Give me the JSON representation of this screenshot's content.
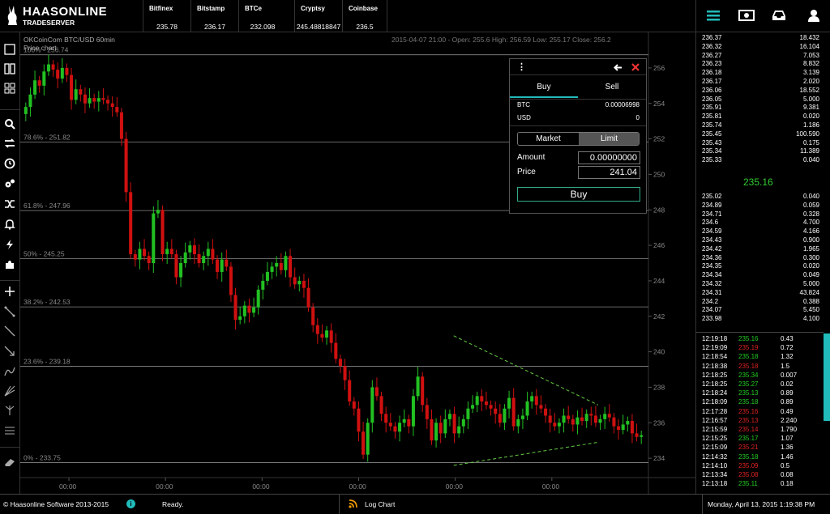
{
  "app": {
    "name": "HAASONLINE",
    "subtitle": "TRADESERVER"
  },
  "tickers": [
    {
      "exchange": "Bitfinex",
      "price": "235.78"
    },
    {
      "exchange": "Bitstamp",
      "price": "236.17"
    },
    {
      "exchange": "BTCe",
      "price": "232.098"
    },
    {
      "exchange": "Cryptsy",
      "price": "245.48818847"
    },
    {
      "exchange": "Coinbase",
      "price": "236.5"
    }
  ],
  "top_icons": [
    "menu-icon",
    "money-icon",
    "inbox-icon",
    "user-icon"
  ],
  "chart": {
    "title": "OKCoinCom BTC/USD 60min",
    "subtitle": "Price chart",
    "ohlc": "2015-04-07 21:00 - Open: 255.6 High: 256.59 Low: 255.17 Close: 256.2",
    "colors": {
      "up": "#22c022",
      "down": "#d01010",
      "fib": "#888888",
      "trend": "#66cc44"
    }
  },
  "chart_data": {
    "type": "candlestick",
    "title": "OKCoinCom BTC/USD 60min",
    "ylim": [
      233,
      257
    ],
    "y_ticks": [
      234,
      236,
      238,
      240,
      242,
      244,
      246,
      248,
      250,
      252,
      254,
      256
    ],
    "x_tick_labels": [
      "00:00",
      "00:00",
      "00:00",
      "00:00",
      "00:00",
      "00:00"
    ],
    "fib_levels": [
      {
        "label": "100% - 256.74",
        "value": 256.74
      },
      {
        "label": "78.6% - 251.82",
        "value": 251.82
      },
      {
        "label": "61.8% - 247.96",
        "value": 247.96
      },
      {
        "label": "50% - 245.25",
        "value": 245.25
      },
      {
        "label": "38.2% - 242.53",
        "value": 242.53
      },
      {
        "label": "23.6% - 239.18",
        "value": 239.18
      },
      {
        "label": "0% - 233.75",
        "value": 233.75
      }
    ],
    "close": [
      253.8,
      254.5,
      255.3,
      255.0,
      255.8,
      256.2,
      255.9,
      255.4,
      256.0,
      255.6,
      254.2,
      254.8,
      254.5,
      254.0,
      254.3,
      254.1,
      254.3,
      254.2,
      254.0,
      253.8,
      253.5,
      252.0,
      249.0,
      245.5,
      245.2,
      245.8,
      245.4,
      245.0,
      247.8,
      248.0,
      245.5,
      245.8,
      245.5,
      244.2,
      245.0,
      245.6,
      246.0,
      245.5,
      245.0,
      245.4,
      245.8,
      245.2,
      244.5,
      245.2,
      244.8,
      243.2,
      241.8,
      242.0,
      242.6,
      242.2,
      242.5,
      243.5,
      244.0,
      244.5,
      244.8,
      245.0,
      244.6,
      245.4,
      244.2,
      243.8,
      244.0,
      243.6,
      242.5,
      241.5,
      241.0,
      240.8,
      241.2,
      240.5,
      239.6,
      239.2,
      238.4,
      237.2,
      236.8,
      235.5,
      234.2,
      236.0,
      238.0,
      237.5,
      236.5,
      236.0,
      235.8,
      235.5,
      236.0,
      236.2,
      235.8,
      237.5,
      238.6,
      237.0,
      236.2,
      235.0,
      236.0,
      235.4,
      236.2,
      236.5,
      235.4,
      235.8,
      236.2,
      236.8,
      237.0,
      237.5,
      237.2,
      237.0,
      236.8,
      236.5,
      236.0,
      236.8,
      237.4,
      235.8,
      236.2,
      236.4,
      237.2,
      237.5,
      237.0,
      236.8,
      236.4,
      236.0,
      235.8,
      236.0,
      236.4,
      236.2,
      235.9,
      236.3,
      236.1,
      236.5,
      236.4,
      236.0,
      236.2,
      236.5,
      236.3,
      235.8,
      235.6,
      235.9,
      236.1,
      235.4,
      235.2,
      235.3
    ],
    "trendlines": [
      {
        "from": [
          0.69,
          240.9
        ],
        "to": [
          0.92,
          237.0
        ]
      },
      {
        "from": [
          0.69,
          233.6
        ],
        "to": [
          0.92,
          234.9
        ]
      }
    ]
  },
  "trade_panel": {
    "tabs": [
      "Buy",
      "Sell"
    ],
    "btc_label": "BTC",
    "btc_value": "0.00006998",
    "usd_label": "USD",
    "usd_value": "0",
    "modes": [
      "Market",
      "Limit"
    ],
    "amount_label": "Amount",
    "amount_value": "0.00000000",
    "price_label": "Price",
    "price_value": "241.04",
    "buy_label": "Buy"
  },
  "orderbook": {
    "asks": [
      [
        "236.37",
        "18.432"
      ],
      [
        "236.32",
        "16.104"
      ],
      [
        "236.27",
        "7.053"
      ],
      [
        "236.23",
        "8.832"
      ],
      [
        "236.18",
        "3.139"
      ],
      [
        "236.17",
        "2.020"
      ],
      [
        "236.06",
        "18.552"
      ],
      [
        "236.05",
        "5.000"
      ],
      [
        "235.91",
        "9.381"
      ],
      [
        "235.81",
        "0.020"
      ],
      [
        "235.74",
        "1.186"
      ],
      [
        "235.45",
        "100.590"
      ],
      [
        "235.43",
        "0.175"
      ],
      [
        "235.34",
        "11.389"
      ],
      [
        "235.33",
        "0.040"
      ]
    ],
    "spread_price": "235.16",
    "bids": [
      [
        "235.02",
        "0.040"
      ],
      [
        "234.89",
        "0.059"
      ],
      [
        "234.71",
        "0.328"
      ],
      [
        "234.6",
        "4.700"
      ],
      [
        "234.59",
        "4.166"
      ],
      [
        "234.43",
        "0.900"
      ],
      [
        "234.42",
        "1.965"
      ],
      [
        "234.36",
        "0.300"
      ],
      [
        "234.35",
        "0.020"
      ],
      [
        "234.34",
        "0.049"
      ],
      [
        "234.32",
        "5.000"
      ],
      [
        "234.31",
        "43.824"
      ],
      [
        "234.2",
        "0.388"
      ],
      [
        "234.07",
        "5.450"
      ],
      [
        "233.98",
        "4.100"
      ]
    ]
  },
  "trades": [
    [
      "12:19:18",
      "235.16",
      "0.43",
      "up"
    ],
    [
      "12:19:09",
      "235.19",
      "0.72",
      "down"
    ],
    [
      "12:18:54",
      "235.18",
      "1.32",
      "up"
    ],
    [
      "12:18:38",
      "235.18",
      "1.5",
      "down"
    ],
    [
      "12:18:25",
      "235.34",
      "0.007",
      "up"
    ],
    [
      "12:18:25",
      "235.27",
      "0.02",
      "up"
    ],
    [
      "12:18:24",
      "235.13",
      "0.89",
      "up"
    ],
    [
      "12:18:09",
      "235.18",
      "0.89",
      "up"
    ],
    [
      "12:17:28",
      "235.16",
      "0.49",
      "down"
    ],
    [
      "12:16:57",
      "235.13",
      "2.240",
      "down"
    ],
    [
      "12:15:59",
      "235.14",
      "1.790",
      "down"
    ],
    [
      "12:15:25",
      "235.17",
      "1.07",
      "up"
    ],
    [
      "12:15:09",
      "235.21",
      "1.36",
      "down"
    ],
    [
      "12:14:32",
      "235.18",
      "1.46",
      "up"
    ],
    [
      "12:14:10",
      "235.09",
      "0.5",
      "down"
    ],
    [
      "12:13:34",
      "235.08",
      "0.08",
      "down"
    ],
    [
      "12:13:18",
      "235.11",
      "0.18",
      "up"
    ]
  ],
  "status": {
    "copyright": "© Haasonline Software 2013-2015",
    "ready": "Ready.",
    "log_chart": "Log Chart",
    "datetime": "Monday, April 13, 2015 1:19:38 PM"
  }
}
